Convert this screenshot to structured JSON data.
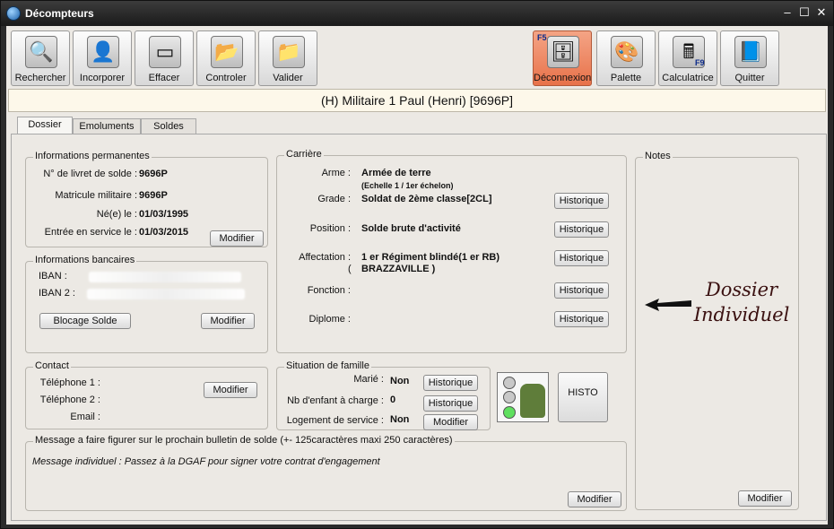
{
  "window": {
    "title": "Décompteurs"
  },
  "toolbar": {
    "left": [
      {
        "label": "Rechercher",
        "icon": "magnifier-icon",
        "glyph": "🔍"
      },
      {
        "label": "Incorporer",
        "icon": "person-add-icon",
        "glyph": "👤"
      },
      {
        "label": "Effacer",
        "icon": "eraser-icon",
        "glyph": "▭"
      },
      {
        "label": "Controler",
        "icon": "folder-check-icon",
        "glyph": "📂"
      },
      {
        "label": "Valider",
        "icon": "folder-validate-icon",
        "glyph": "📁"
      }
    ],
    "right": [
      {
        "label": "Déconnexion",
        "icon": "disconnect-icon",
        "glyph": "🗄",
        "corner": "F5"
      },
      {
        "label": "Palette",
        "icon": "palette-icon",
        "glyph": "🎨"
      },
      {
        "label": "Calculatrice",
        "icon": "calculator-icon",
        "glyph": "🖩",
        "corner": "F9"
      },
      {
        "label": "Quitter",
        "icon": "exit-book-icon",
        "glyph": "📘"
      }
    ]
  },
  "header": {
    "text": "(H) Militaire 1  Paul (Henri)   [9696P]"
  },
  "tabs": [
    "Dossier",
    "Emoluments",
    "Soldes"
  ],
  "permanentes": {
    "title": "Informations permanentes",
    "livret_label": "N° de livret de solde :",
    "livret_value": "9696P",
    "matricule_label": "Matricule militaire :",
    "matricule_value": "9696P",
    "naissance_label": "Né(e) le :",
    "naissance_value": "01/03/1995",
    "entree_label": "Entrée en service le :",
    "entree_value": "01/03/2015",
    "modifier": "Modifier"
  },
  "bancaires": {
    "title": "Informations bancaires",
    "iban1_label": "IBAN    :",
    "iban2_label": "IBAN 2 :",
    "blocage": "Blocage Solde",
    "modifier": "Modifier"
  },
  "contact": {
    "title": "Contact",
    "tel1": "Téléphone 1 :",
    "tel2": "Téléphone 2 :",
    "email": "Email :",
    "modifier": "Modifier"
  },
  "carriere": {
    "title": "Carrière",
    "arme_label": "Arme :",
    "arme_value": "Armée de terre",
    "echelle": "(Echelle 1 / 1er échelon)",
    "grade_label": "Grade :",
    "grade_value": "Soldat de 2ème classe[2CL]",
    "position_label": "Position :",
    "position_value": "Solde brute d'activité",
    "affectation_label": "Affectation :",
    "affectation_value": "1 er Régiment blindé(1 er RB)",
    "affectation_paren": "(",
    "affectation_city": "BRAZZAVILLE )",
    "fonction_label": "Fonction :",
    "diplome_label": "Diplome :",
    "historique": "Historique"
  },
  "famille": {
    "title": "Situation de famille",
    "marie_label": "Marié :",
    "marie_value": "Non",
    "enfants_label": "Nb d'enfant à charge :",
    "enfants_value": "0",
    "logement_label": "Logement de service :",
    "logement_value": "Non",
    "historique": "Historique",
    "modifier": "Modifier"
  },
  "histo": {
    "label": "HISTO"
  },
  "message": {
    "title": "Message a faire figurer sur le prochain bulletin de solde (+- 125caractères maxi 250 caractères)",
    "text": "Message individuel : Passez à la DGAF pour signer votre contrat d'engagement",
    "modifier": "Modifier"
  },
  "notes": {
    "title": "Notes",
    "annotation_line1": "Dossier",
    "annotation_line2": "Individuel",
    "modifier": "Modifier"
  },
  "colors": {
    "accent_active": "#e8724a",
    "header_bg": "#fdf8ea",
    "panel_bg": "#ece9e4"
  }
}
